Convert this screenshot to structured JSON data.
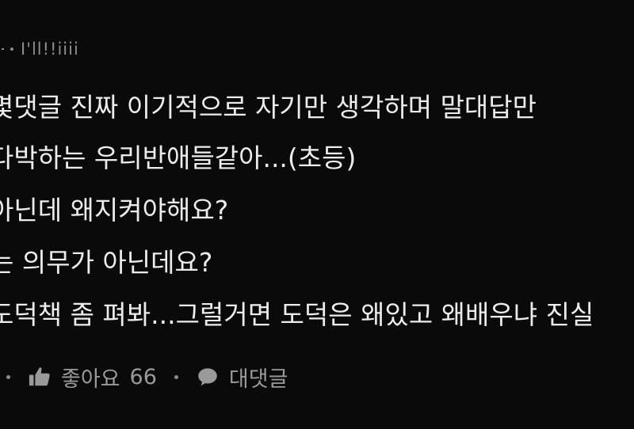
{
  "comment": {
    "author": "I'll!!iiii",
    "lines": [
      "몇댓글 진짜 이기적으로 자기만 생각하며 말대답만",
      "다박하는 우리반애들같아...(초등)",
      "아닌데 왜지켜야해요?",
      "는 의무가 아닌데요?",
      "도덕책 좀 펴봐...그럴거면 도덕은 왜있고 왜배우냐 진실"
    ],
    "actions": {
      "like_icon": "thumbs-up-icon",
      "like_label": "좋아요",
      "like_count": "66",
      "reply_icon": "speech-bubble-icon",
      "reply_label": "대댓글"
    }
  }
}
